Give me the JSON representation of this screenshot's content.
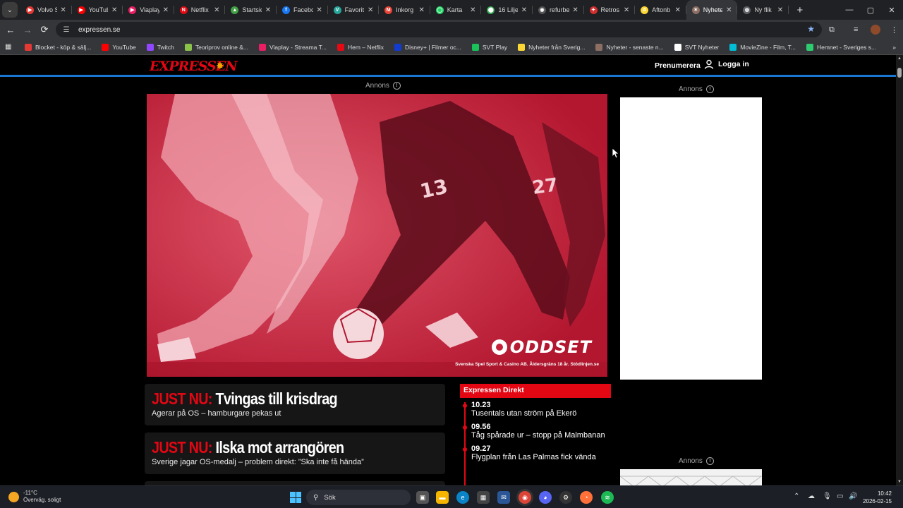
{
  "browser": {
    "tabs": [
      {
        "title": "Volvo S",
        "color": "#e53935",
        "glyph": "▶"
      },
      {
        "title": "YouTub",
        "color": "#ff0000",
        "glyph": "▶"
      },
      {
        "title": "Viaplay",
        "color": "#e91e63",
        "glyph": "▶"
      },
      {
        "title": "Netflix",
        "color": "#e50914",
        "glyph": "N"
      },
      {
        "title": "Startsid",
        "color": "#43a047",
        "glyph": "▲"
      },
      {
        "title": "Facebo",
        "color": "#1877f2",
        "glyph": "f"
      },
      {
        "title": "Favorit",
        "color": "#26a69a",
        "glyph": "V"
      },
      {
        "title": "Inkorg",
        "color": "#ea4335",
        "glyph": "M"
      },
      {
        "title": "Karta",
        "color": "#25d366",
        "glyph": "◯"
      },
      {
        "title": "16 Lilje",
        "color": "#34a853",
        "glyph": "⬤"
      },
      {
        "title": "refurbe",
        "color": "#555555",
        "glyph": "◉"
      },
      {
        "title": "Retros",
        "color": "#d32f2f",
        "glyph": "✦"
      },
      {
        "title": "Aftonb",
        "color": "#fdd835",
        "glyph": "A"
      },
      {
        "title": "Nyhete",
        "color": "#8d6e63",
        "glyph": "✶"
      },
      {
        "title": "Ny flik",
        "color": "#5f6368",
        "glyph": "◍"
      }
    ],
    "active_tab_index": 13,
    "url": "expressen.se",
    "bookmarks": [
      {
        "label": "Blocket - köp & sälj...",
        "color": "#e53935"
      },
      {
        "label": "YouTube",
        "color": "#ff0000"
      },
      {
        "label": "Twitch",
        "color": "#9146ff"
      },
      {
        "label": "Teoriprov online &...",
        "color": "#8bc34a"
      },
      {
        "label": "Viaplay - Streama T...",
        "color": "#e91e63"
      },
      {
        "label": "Hem – Netflix",
        "color": "#e50914"
      },
      {
        "label": "Disney+ | Filmer oc...",
        "color": "#113ccf"
      },
      {
        "label": "SVT Play",
        "color": "#19c35a"
      },
      {
        "label": "Nyheter från Sverig...",
        "color": "#fdd835"
      },
      {
        "label": "Nyheter - senaste n...",
        "color": "#8d6e63"
      },
      {
        "label": "SVT Nyheter",
        "color": "#ffffff"
      },
      {
        "label": "MovieZine - Film, T...",
        "color": "#00bcd4"
      },
      {
        "label": "Hemnet - Sveriges s...",
        "color": "#2ecc71"
      }
    ]
  },
  "site": {
    "logo": "EXPRESSEN",
    "subscribe_label": "Prenumerera",
    "login_label": "Logga in",
    "annons_label": "Annons",
    "ad_brand": "ODDSET",
    "ad_disclaimer": "Svenska Spel Sport & Casino AB. Åldersgräns 18 år. Stödlinjen.se",
    "ad_jersey_numbers": [
      "13",
      "27"
    ],
    "stories": [
      {
        "kicker": "JUST NU:",
        "headline": "Tvingas till krisdrag",
        "sub": "Agerar på OS – hamburgare pekas ut"
      },
      {
        "kicker": "JUST NU:",
        "headline": "Ilska mot arrangören",
        "sub": "Sverige jagar OS-medalj – problem direkt: ”Ska inte få hända”"
      }
    ],
    "direkt": {
      "title": "Expressen Direkt",
      "items": [
        {
          "time": "10.23",
          "text": "Tusentals utan ström på Ekerö"
        },
        {
          "time": "09.56",
          "text": "Tåg spårade ur – stopp på Malmbanan"
        },
        {
          "time": "09.27",
          "text": "Flygplan från Las Palmas fick vända"
        }
      ]
    }
  },
  "taskbar": {
    "weather_temp": "-11°C",
    "weather_desc": "Överväg. soligt",
    "search_placeholder": "Sök",
    "time": "10:42",
    "date": "2026-02-15"
  }
}
